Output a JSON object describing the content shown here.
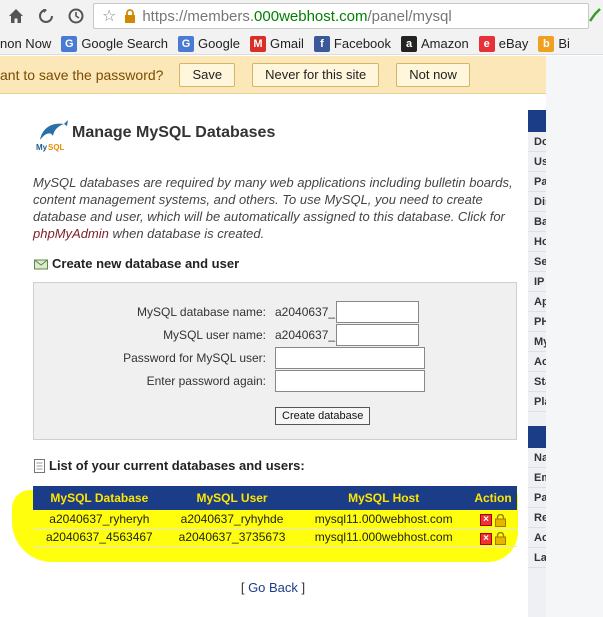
{
  "browser": {
    "url_prefix": "https://members.",
    "url_host": "000webhost.com",
    "url_path": "/panel/mysql",
    "bookmarks": [
      {
        "label": "non Now",
        "icon": "page-icon",
        "color": "#999999"
      },
      {
        "label": "Google Search",
        "icon": "google-icon",
        "color": "#4a7bd4"
      },
      {
        "label": "Google",
        "icon": "google-icon",
        "color": "#4a7bd4"
      },
      {
        "label": "Gmail",
        "icon": "gmail-icon",
        "color": "#d93025"
      },
      {
        "label": "Facebook",
        "icon": "facebook-icon",
        "color": "#3b5998"
      },
      {
        "label": "Amazon",
        "icon": "amazon-icon",
        "color": "#222222"
      },
      {
        "label": "eBay",
        "icon": "ebay-icon",
        "color": "#e53238"
      },
      {
        "label": "Bi",
        "icon": "bing-icon",
        "color": "#f0a020"
      }
    ],
    "password_prompt": {
      "text": "ant to save the password?",
      "save_label": "Save",
      "never_label": "Never for this site",
      "not_now_label": "Not now"
    }
  },
  "page": {
    "title": "Manage MySQL Databases",
    "intro_text": "MySQL databases are required by many web applications including bulletin boards, content management systems, and others. To use MySQL, you need to create database and user, which will be automatically assigned to this database. Click for ",
    "intro_link": "phpMyAdmin",
    "intro_tail": " when database is created.",
    "create_section_title": "Create new database and user",
    "form": {
      "db_name_label": "MySQL database name:",
      "db_prefix": "a2040637_",
      "user_name_label": "MySQL user name:",
      "user_prefix": "a2040637_",
      "password_label": "Password for MySQL user:",
      "password_again_label": "Enter password again:",
      "create_button": "Create database"
    },
    "list_section_title": "List of your current databases and users:",
    "table": {
      "headers": [
        "MySQL Database",
        "MySQL User",
        "MySQL Host",
        "Action"
      ],
      "rows": [
        {
          "database": "a2040637_ryheryh",
          "user": "a2040637_ryhyhde",
          "host": "mysql11.000webhost.com"
        },
        {
          "database": "a2040637_4563467",
          "user": "a2040637_3735673",
          "host": "mysql11.000webhost.com"
        }
      ]
    },
    "go_back_open": "[ ",
    "go_back": "Go Back",
    "go_back_close": " ]"
  },
  "sidebar": {
    "group1": [
      "Do",
      "Us",
      "Pa",
      "Dis",
      "Ba",
      "Ho",
      "Se",
      "IP",
      "Ap",
      "PH",
      "My",
      "Ac",
      "Sta",
      "Pla"
    ],
    "group2": [
      "Na",
      "Em",
      "Pa",
      "Re",
      "Ac",
      "La"
    ]
  },
  "colors": {
    "table_header_bg": "#1b3c86",
    "table_header_text": "#ffe600",
    "highlight": "#ffff00",
    "password_bar": "#fbe7b8"
  }
}
